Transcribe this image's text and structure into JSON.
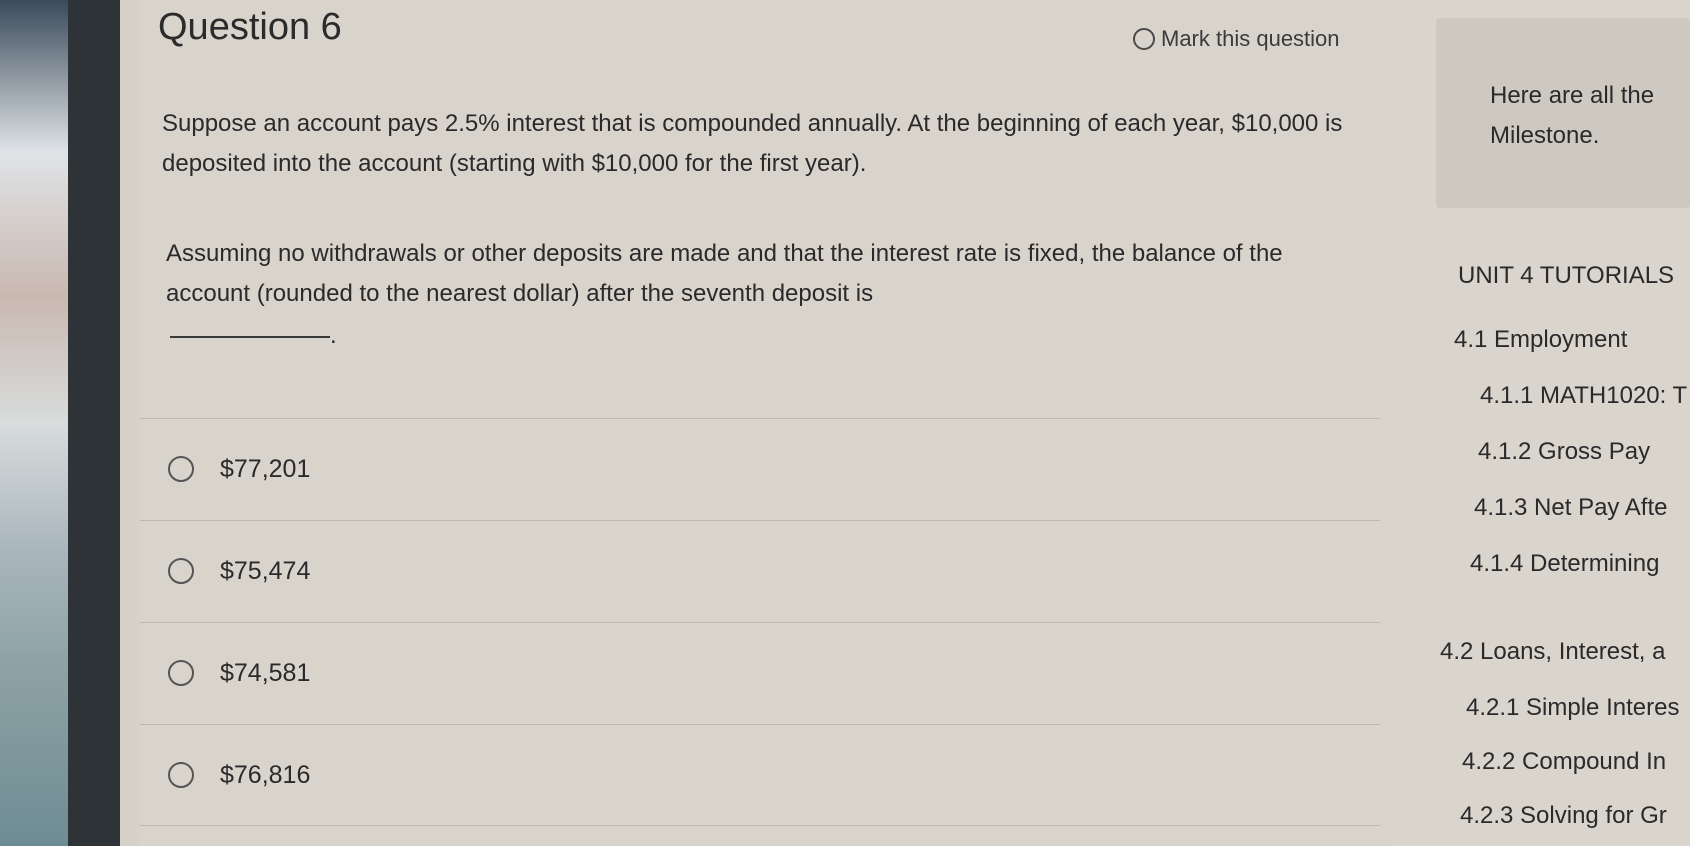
{
  "question": {
    "title": "Question 6",
    "mark_label": "Mark this question",
    "paragraph1": "Suppose an account pays 2.5% interest that is compounded annually. At the beginning of each year, $10,000 is deposited into the account (starting with $10,000 for the first year).",
    "paragraph2": "Assuming no withdrawals or other deposits are made and that the interest rate is fixed, the balance of the account (rounded to the nearest dollar) after the seventh deposit is",
    "blank_suffix": "."
  },
  "options": [
    "$77,201",
    "$75,474",
    "$74,581",
    "$76,816"
  ],
  "sidebar": {
    "intro_line1": "Here are all the",
    "intro_line2": "Milestone.",
    "heading": "UNIT 4 TUTORIALS",
    "items": [
      "4.1 Employment",
      "4.1.1 MATH1020: T",
      "4.1.2 Gross Pay",
      "4.1.3 Net Pay Afte",
      "4.1.4 Determining",
      "4.2 Loans, Interest, a",
      "4.2.1 Simple Interes",
      "4.2.2 Compound In",
      "4.2.3 Solving for Gr"
    ]
  }
}
